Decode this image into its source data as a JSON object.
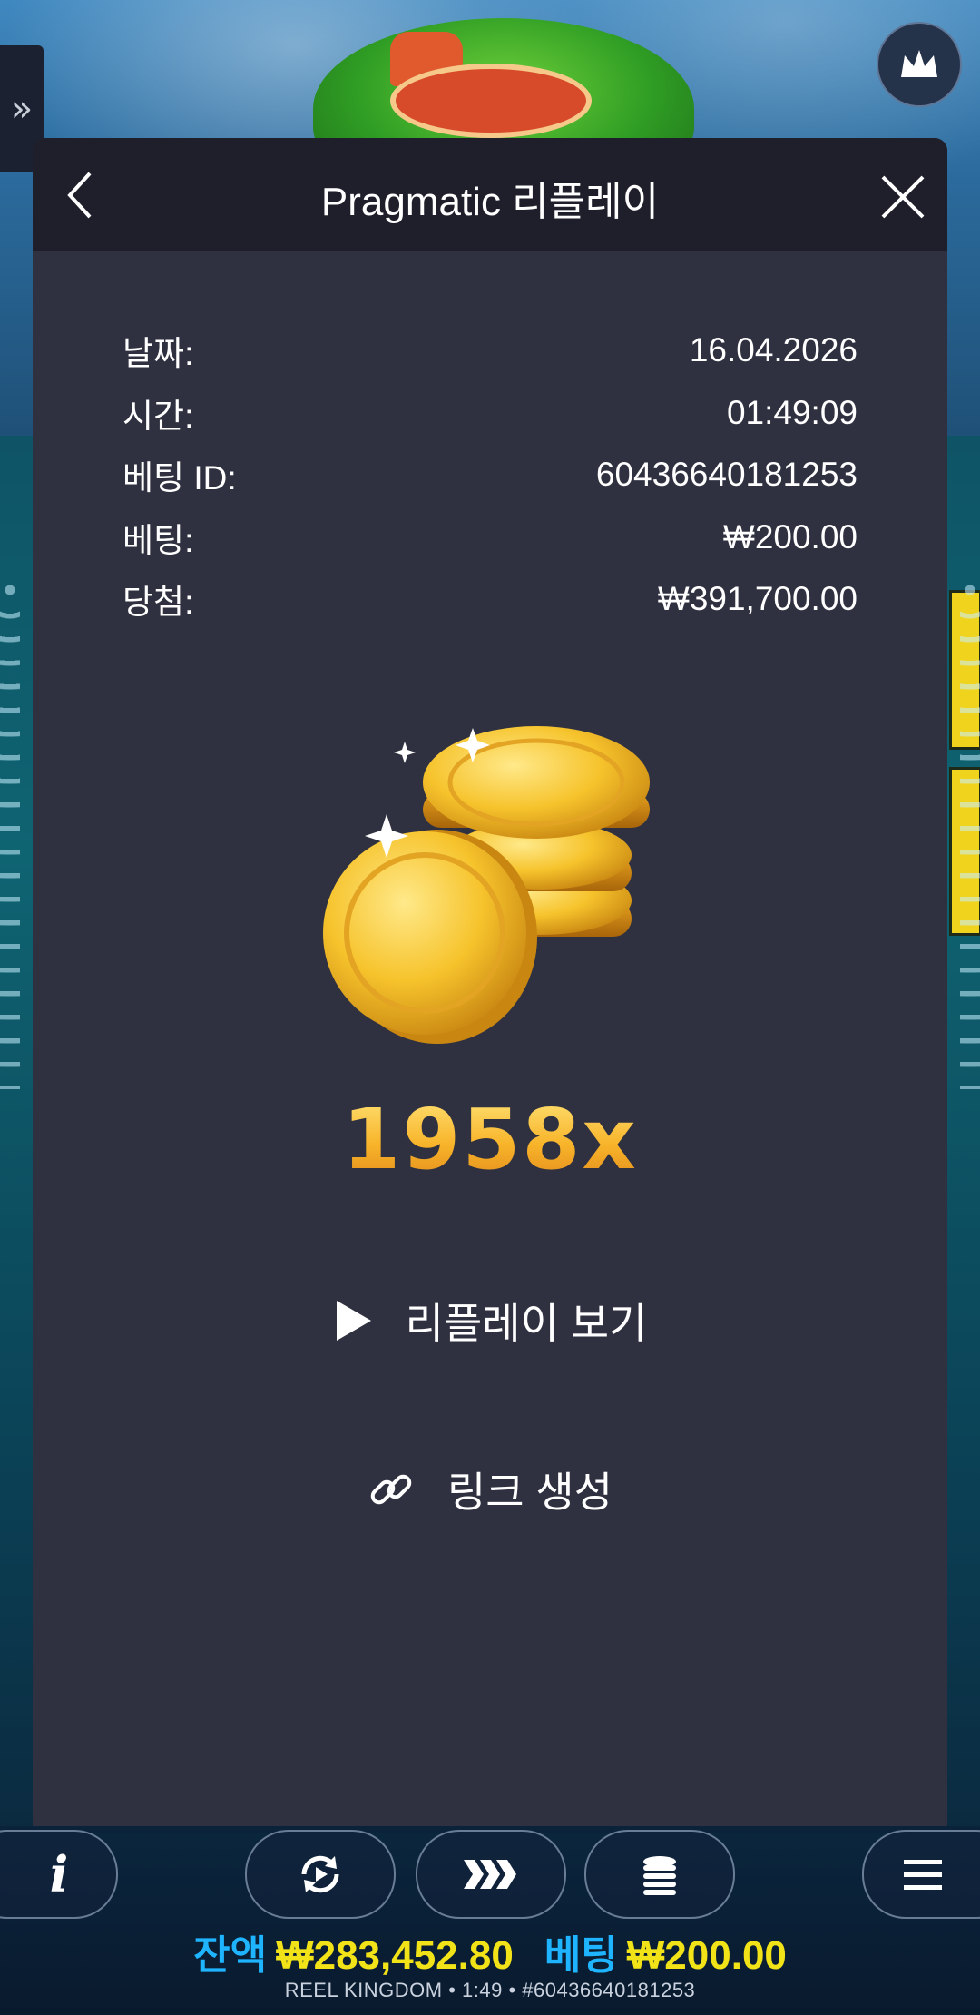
{
  "modal": {
    "title": "Pragmatic 리플레이",
    "rows": [
      {
        "label": "날짜:",
        "value": "16.04.2026"
      },
      {
        "label": "시간:",
        "value": "01:49:09"
      },
      {
        "label": "베팅 ID:",
        "value": "60436640181253"
      },
      {
        "label": "베팅:",
        "value": "₩200.00"
      },
      {
        "label": "당첨:",
        "value": "₩391,700.00"
      }
    ],
    "multiplier": "1958x",
    "replay_label": "리플레이 보기",
    "link_label": "링크 생성"
  },
  "side_tab": {
    "icon": "double-chevron-right-icon",
    "glyph": "»"
  },
  "bottom": {
    "balance_label": "잔액",
    "balance_value": "₩283,452.80",
    "bet_label": "베팅",
    "bet_value": "₩200.00",
    "footer": "REEL KINGDOM • 1:49 • #60436640181253"
  },
  "colors": {
    "modal_bg": "#303140",
    "header_bg": "#1e1f2a",
    "multiplier_gold": "#f8b42a",
    "balance_label_blue": "#1fb4ff",
    "balance_value_yellow": "#f2e318"
  }
}
